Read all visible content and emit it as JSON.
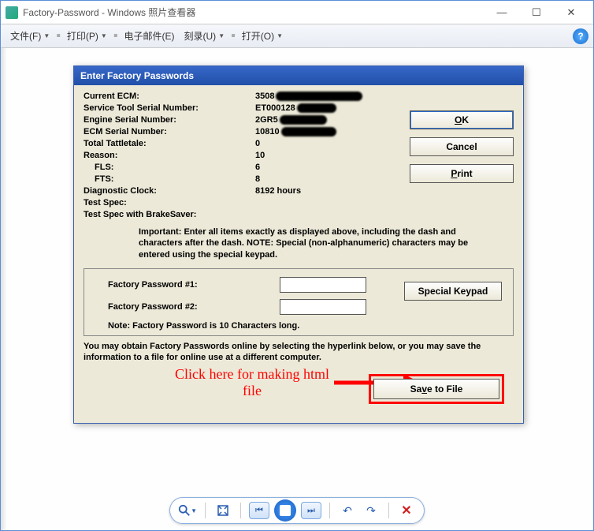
{
  "window": {
    "title": "Factory-Password - Windows 照片查看器"
  },
  "menubar": {
    "file": "文件(F)",
    "print": "打印(P)",
    "email": "电子邮件(E)",
    "burn": "刻录(U)",
    "open": "打开(O)"
  },
  "dialog": {
    "title": "Enter Factory Passwords",
    "rows": {
      "current_ecm_label": "Current ECM:",
      "current_ecm_value": "3508",
      "service_tool_label": "Service Tool Serial Number:",
      "service_tool_value": "ET000128",
      "engine_serial_label": "Engine Serial Number:",
      "engine_serial_value": "2GR5",
      "ecm_serial_label": "ECM Serial Number:",
      "ecm_serial_value": "10810",
      "tattletale_label": "Total Tattletale:",
      "tattletale_value": "0",
      "reason_label": "Reason:",
      "reason_value": "10",
      "fls_label": "FLS:",
      "fls_value": "6",
      "fts_label": "FTS:",
      "fts_value": "8",
      "diag_clock_label": "Diagnostic Clock:",
      "diag_clock_value": "8192 hours",
      "test_spec_label": "Test Spec:",
      "test_spec_bs_label": "Test Spec with BrakeSaver:"
    },
    "buttons": {
      "ok": "OK",
      "cancel": "Cancel",
      "print": "Print",
      "special_keypad": "Special Keypad",
      "save_to_file": "Save to File"
    },
    "important": "Important: Enter all items exactly as displayed above, including the dash and characters after the dash.  NOTE: Special (non-alphanumeric) characters may be entered using the special keypad.",
    "password": {
      "label1": "Factory Password #1:",
      "label2": "Factory Password #2:",
      "value1": "",
      "value2": "",
      "note": "Note: Factory Password is 10 Characters long."
    },
    "obtain": "You may obtain Factory Passwords online by selecting the hyperlink below, or you may save the information to a file for online use at a different computer."
  },
  "annotation": {
    "text1": "Click here for making html",
    "text2": "file"
  },
  "win_controls": {
    "min": "—",
    "max": "☐",
    "close": "✕"
  }
}
